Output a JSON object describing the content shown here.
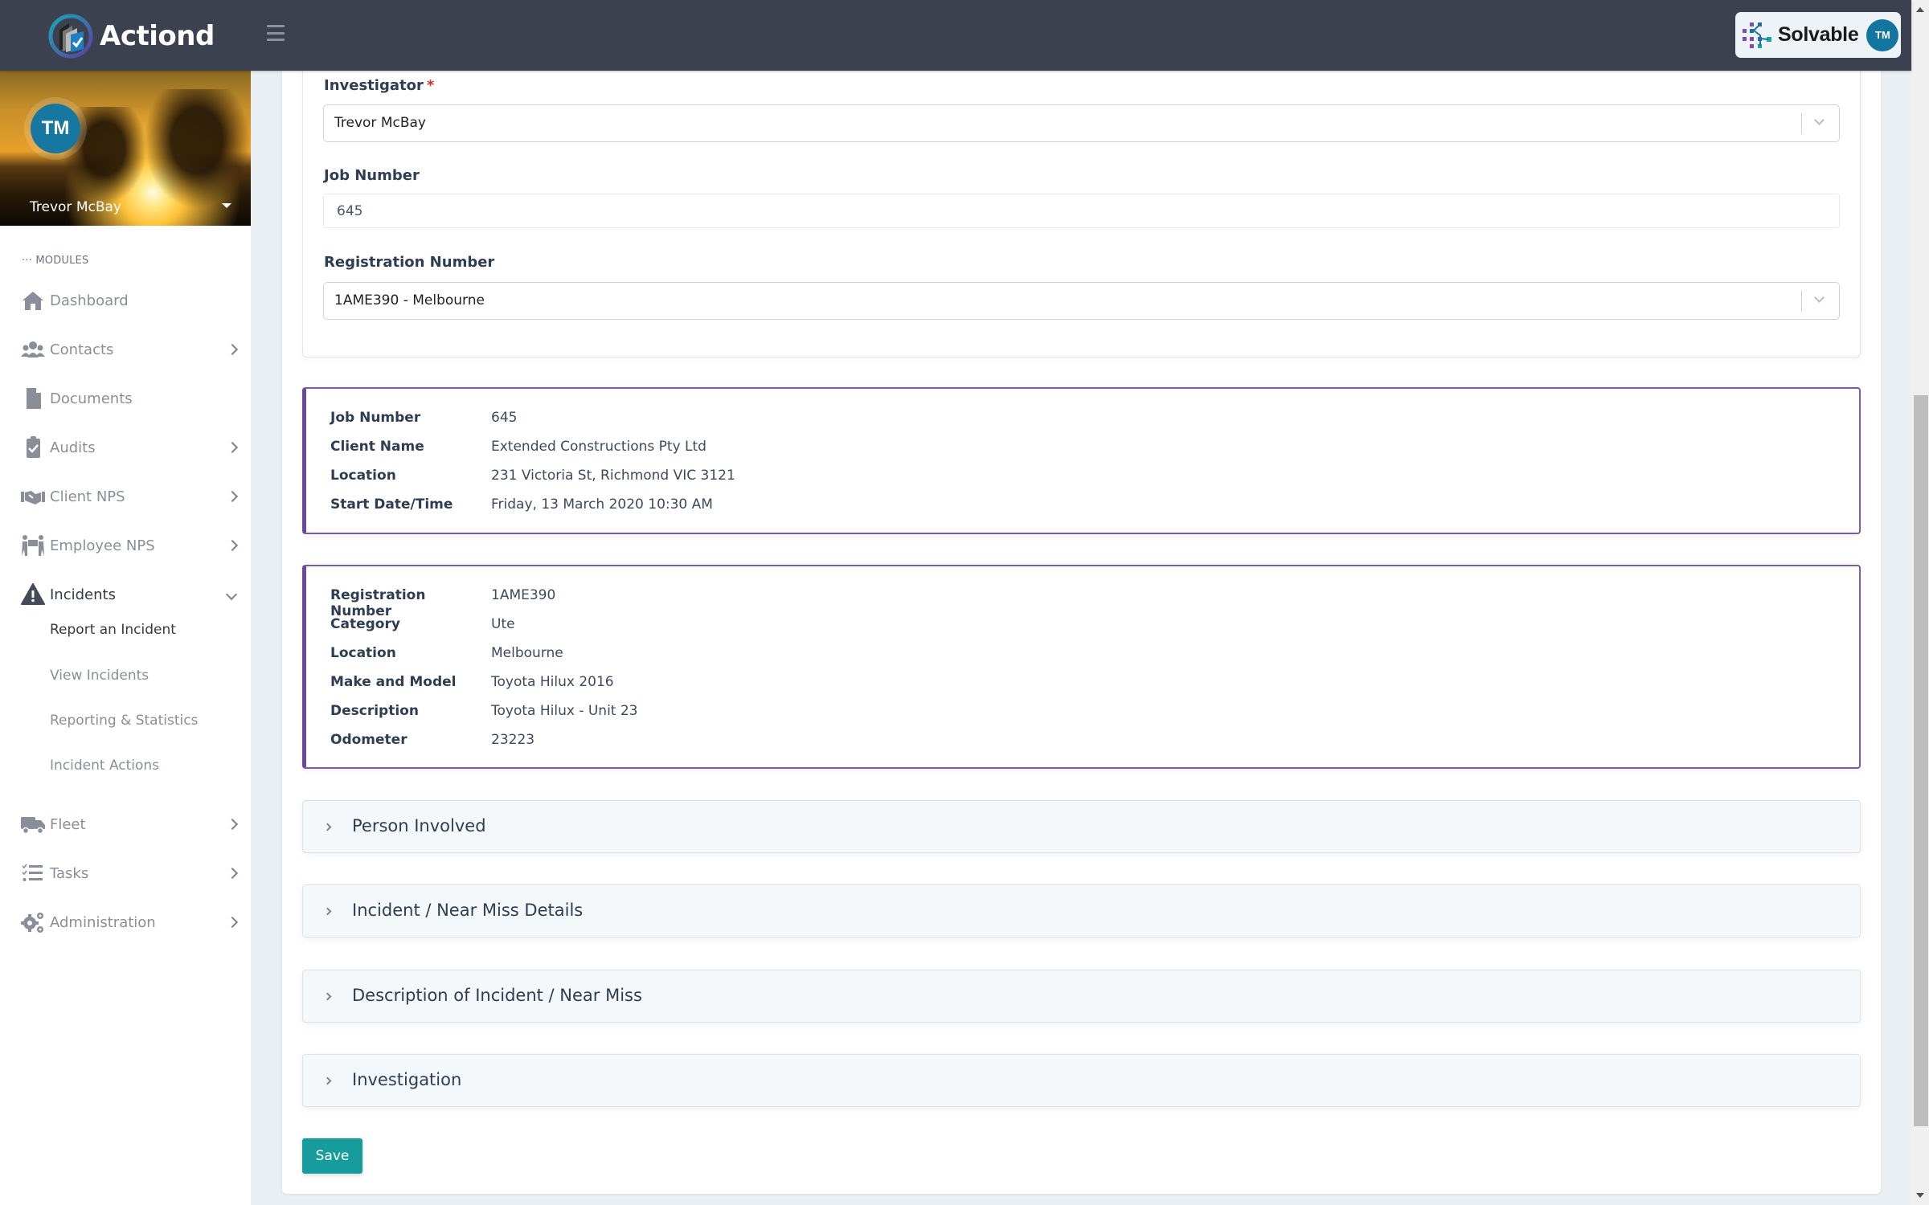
{
  "header": {
    "brand_name": "Actiond",
    "partner_name": "Solvable",
    "user_initials": "TM"
  },
  "profile": {
    "initials": "TM",
    "name": "Trevor McBay"
  },
  "sidebar": {
    "section_label": "MODULES",
    "items": [
      {
        "label": "Dashboard",
        "icon": "home-icon",
        "has_children": false
      },
      {
        "label": "Contacts",
        "icon": "users-icon",
        "has_children": true
      },
      {
        "label": "Documents",
        "icon": "file-icon",
        "has_children": false
      },
      {
        "label": "Audits",
        "icon": "clipboard-check-icon",
        "has_children": true
      },
      {
        "label": "Client NPS",
        "icon": "handshake-icon",
        "has_children": true
      },
      {
        "label": "Employee NPS",
        "icon": "people-carry-icon",
        "has_children": true
      },
      {
        "label": "Incidents",
        "icon": "warning-icon",
        "has_children": true,
        "expanded": true
      },
      {
        "label": "Fleet",
        "icon": "truck-icon",
        "has_children": true
      },
      {
        "label": "Tasks",
        "icon": "tasks-icon",
        "has_children": true
      },
      {
        "label": "Administration",
        "icon": "cogs-icon",
        "has_children": true
      }
    ],
    "incidents_subitems": [
      {
        "label": "Report an Incident",
        "current": true
      },
      {
        "label": "View Incidents"
      },
      {
        "label": "Reporting & Statistics"
      },
      {
        "label": "Incident Actions"
      }
    ]
  },
  "form": {
    "investigator": {
      "label": "Investigator",
      "required_mark": "*",
      "value": "Trevor McBay"
    },
    "job_number": {
      "label": "Job Number",
      "value": "645"
    },
    "registration_number": {
      "label": "Registration Number",
      "value": "1AME390 - Melbourne"
    }
  },
  "job_info": {
    "rows": [
      {
        "key": "Job Number",
        "value": "645"
      },
      {
        "key": "Client Name",
        "value": "Extended Constructions Pty Ltd"
      },
      {
        "key": "Location",
        "value": "231 Victoria St, Richmond VIC 3121"
      },
      {
        "key": "Start Date/Time",
        "value": "Friday, 13 March 2020 10:30 AM"
      }
    ]
  },
  "vehicle_info": {
    "rows": [
      {
        "key": "Registration Number",
        "value": "1AME390"
      },
      {
        "key": "Category",
        "value": "Ute"
      },
      {
        "key": "Location",
        "value": "Melbourne"
      },
      {
        "key": "Make and Model",
        "value": "Toyota Hilux 2016"
      },
      {
        "key": "Description",
        "value": "Toyota Hilux - Unit 23"
      },
      {
        "key": "Odometer",
        "value": "23223"
      }
    ]
  },
  "accordions": [
    {
      "title": "Person Involved"
    },
    {
      "title": "Incident / Near Miss Details"
    },
    {
      "title": "Description of Incident / Near Miss"
    },
    {
      "title": "Investigation"
    }
  ],
  "actions": {
    "save_label": "Save"
  },
  "colors": {
    "header_bg": "#3b414f",
    "accent_teal": "#179c9e",
    "info_border_purple": "#6a4a9e",
    "avatar_blue": "#1677a1"
  }
}
